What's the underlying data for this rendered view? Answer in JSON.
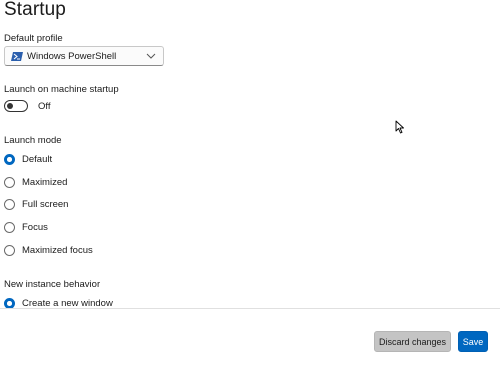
{
  "page": {
    "title": "Startup"
  },
  "default_profile": {
    "label": "Default profile",
    "value": "Windows PowerShell",
    "icon": "powershell-icon"
  },
  "launch_on_startup": {
    "label": "Launch on machine startup",
    "state_text": "Off",
    "enabled": false
  },
  "launch_mode": {
    "label": "Launch mode",
    "options": [
      {
        "label": "Default",
        "selected": true
      },
      {
        "label": "Maximized",
        "selected": false
      },
      {
        "label": "Full screen",
        "selected": false
      },
      {
        "label": "Focus",
        "selected": false
      },
      {
        "label": "Maximized focus",
        "selected": false
      }
    ]
  },
  "new_instance_behavior": {
    "label": "New instance behavior",
    "options": [
      {
        "label": "Create a new window",
        "selected": true
      }
    ]
  },
  "footer": {
    "discard_label": "Discard changes",
    "save_label": "Save"
  },
  "colors": {
    "accent": "#0067c0",
    "discard_bg": "#c4c4c4"
  }
}
